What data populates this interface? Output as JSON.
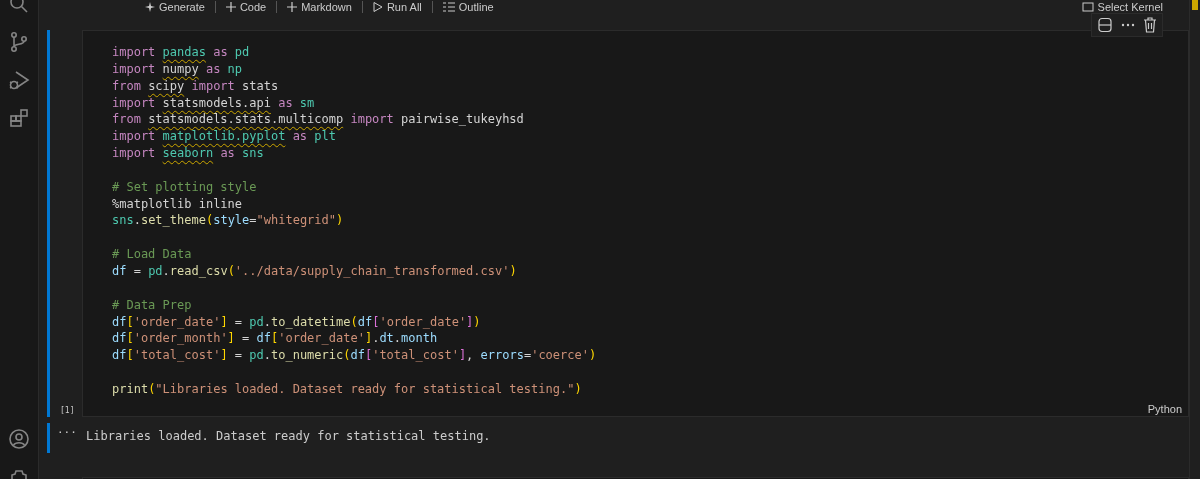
{
  "toolbar": [
    "Generate",
    "Code",
    "Markdown",
    "Run All",
    "Outline"
  ],
  "kernel": {
    "label": "Select Kernel"
  },
  "cell": {
    "execution_count": "[1]",
    "language": "Python",
    "blocks": [
      [
        [
          {
            "text": "import ",
            "kind": "keyword"
          },
          {
            "text": "pandas",
            "kind": "module",
            "warning": true
          },
          {
            "text": " as ",
            "kind": "keyword"
          },
          {
            "text": "pd",
            "kind": "module"
          }
        ],
        [
          {
            "text": "import ",
            "kind": "keyword"
          },
          {
            "text": "numpy",
            "kind": "plain",
            "warning": true
          },
          {
            "text": " as ",
            "kind": "keyword"
          },
          {
            "text": "np",
            "kind": "module"
          }
        ],
        [
          {
            "text": "from ",
            "kind": "keyword"
          },
          {
            "text": "scipy",
            "kind": "plain",
            "warning": true
          },
          {
            "text": " import ",
            "kind": "keyword"
          },
          {
            "text": "stats",
            "kind": "plain"
          }
        ],
        [
          {
            "text": "import ",
            "kind": "keyword"
          },
          {
            "text": "statsmodels.api",
            "kind": "plain",
            "warning": true
          },
          {
            "text": " as ",
            "kind": "keyword"
          },
          {
            "text": "sm",
            "kind": "module"
          }
        ],
        [
          {
            "text": "from ",
            "kind": "keyword"
          },
          {
            "text": "statsmodels.stats.multicomp",
            "kind": "plain",
            "warning": true
          },
          {
            "text": " import ",
            "kind": "keyword"
          },
          {
            "text": "pairwise_tukeyhsd",
            "kind": "plain"
          }
        ],
        [
          {
            "text": "import ",
            "kind": "keyword"
          },
          {
            "text": "matplotlib.pyplot",
            "kind": "module",
            "warning": true
          },
          {
            "text": " as ",
            "kind": "keyword"
          },
          {
            "text": "plt",
            "kind": "module"
          }
        ],
        [
          {
            "text": "import ",
            "kind": "keyword"
          },
          {
            "text": "seaborn",
            "kind": "module",
            "warning": true
          },
          {
            "text": " as ",
            "kind": "keyword"
          },
          {
            "text": "sns",
            "kind": "module"
          }
        ]
      ],
      [
        [
          {
            "text": "# Set plotting style",
            "kind": "comment"
          }
        ],
        [
          {
            "text": "%matplotlib inline",
            "kind": "plain"
          }
        ],
        [
          {
            "text": "sns",
            "kind": "module"
          },
          {
            "text": ".",
            "kind": "plain"
          },
          {
            "text": "set_theme",
            "kind": "function"
          },
          {
            "text": "(",
            "kind": "bracket"
          },
          {
            "text": "style",
            "kind": "variable"
          },
          {
            "text": "=",
            "kind": "plain"
          },
          {
            "text": "\"whitegrid\"",
            "kind": "string"
          },
          {
            "text": ")",
            "kind": "bracket"
          }
        ]
      ],
      [
        [
          {
            "text": "# Load Data",
            "kind": "comment"
          }
        ],
        [
          {
            "text": "df",
            "kind": "variable"
          },
          {
            "text": " = ",
            "kind": "plain"
          },
          {
            "text": "pd",
            "kind": "module"
          },
          {
            "text": ".",
            "kind": "plain"
          },
          {
            "text": "read_csv",
            "kind": "function"
          },
          {
            "text": "(",
            "kind": "bracket"
          },
          {
            "text": "'../data/supply_chain_transformed.csv'",
            "kind": "string"
          },
          {
            "text": ")",
            "kind": "bracket"
          }
        ]
      ],
      [
        [
          {
            "text": "# Data Prep",
            "kind": "comment"
          }
        ],
        [
          {
            "text": "df",
            "kind": "variable"
          },
          {
            "text": "[",
            "kind": "bracket"
          },
          {
            "text": "'order_date'",
            "kind": "string"
          },
          {
            "text": "]",
            "kind": "bracket"
          },
          {
            "text": " = ",
            "kind": "plain"
          },
          {
            "text": "pd",
            "kind": "module"
          },
          {
            "text": ".",
            "kind": "plain"
          },
          {
            "text": "to_datetime",
            "kind": "function"
          },
          {
            "text": "(",
            "kind": "bracket"
          },
          {
            "text": "df",
            "kind": "variable"
          },
          {
            "text": "[",
            "kind": "inner"
          },
          {
            "text": "'order_date'",
            "kind": "string"
          },
          {
            "text": "]",
            "kind": "inner"
          },
          {
            "text": ")",
            "kind": "bracket"
          }
        ],
        [
          {
            "text": "df",
            "kind": "variable"
          },
          {
            "text": "[",
            "kind": "bracket"
          },
          {
            "text": "'order_month'",
            "kind": "string"
          },
          {
            "text": "]",
            "kind": "bracket"
          },
          {
            "text": " = ",
            "kind": "plain"
          },
          {
            "text": "df",
            "kind": "variable"
          },
          {
            "text": "[",
            "kind": "bracket"
          },
          {
            "text": "'order_date'",
            "kind": "string"
          },
          {
            "text": "]",
            "kind": "bracket"
          },
          {
            "text": ".",
            "kind": "plain"
          },
          {
            "text": "dt",
            "kind": "variable"
          },
          {
            "text": ".",
            "kind": "plain"
          },
          {
            "text": "month",
            "kind": "variable"
          }
        ],
        [
          {
            "text": "df",
            "kind": "variable"
          },
          {
            "text": "[",
            "kind": "bracket"
          },
          {
            "text": "'total_cost'",
            "kind": "string"
          },
          {
            "text": "]",
            "kind": "bracket"
          },
          {
            "text": " = ",
            "kind": "plain"
          },
          {
            "text": "pd",
            "kind": "module"
          },
          {
            "text": ".",
            "kind": "plain"
          },
          {
            "text": "to_numeric",
            "kind": "function"
          },
          {
            "text": "(",
            "kind": "bracket"
          },
          {
            "text": "df",
            "kind": "variable"
          },
          {
            "text": "[",
            "kind": "inner"
          },
          {
            "text": "'total_cost'",
            "kind": "string"
          },
          {
            "text": "]",
            "kind": "inner"
          },
          {
            "text": ", ",
            "kind": "plain"
          },
          {
            "text": "errors",
            "kind": "variable"
          },
          {
            "text": "=",
            "kind": "plain"
          },
          {
            "text": "'coerce'",
            "kind": "string"
          },
          {
            "text": ")",
            "kind": "bracket"
          }
        ]
      ],
      [
        [
          {
            "text": "print",
            "kind": "function"
          },
          {
            "text": "(",
            "kind": "bracket"
          },
          {
            "text": "\"Libraries loaded. Dataset ready for statistical testing.\"",
            "kind": "string"
          },
          {
            "text": ")",
            "kind": "bracket"
          }
        ]
      ]
    ]
  },
  "output": {
    "more": "···",
    "text": "Libraries loaded. Dataset ready for statistical testing."
  }
}
